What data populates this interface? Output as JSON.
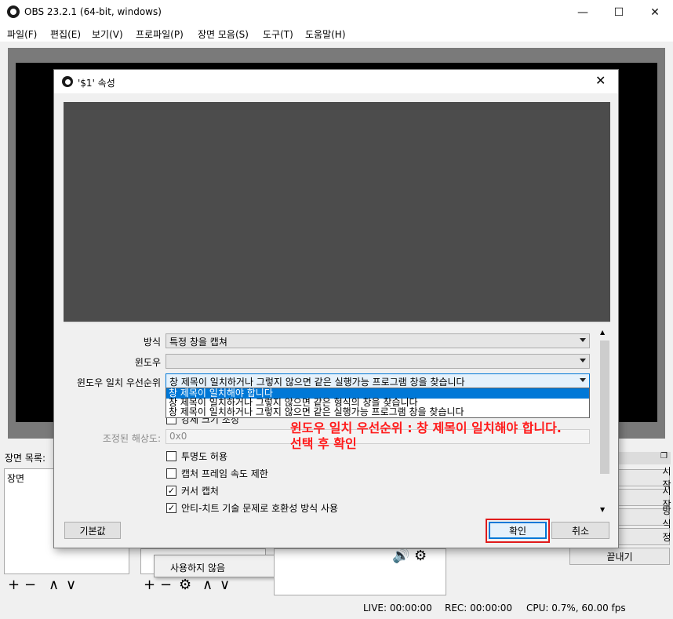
{
  "window": {
    "title": "OBS 23.2.1 (64-bit, windows)",
    "controls": {
      "minimize": "—",
      "maximize": "☐",
      "close": "✕"
    }
  },
  "menu": [
    "파일(F)",
    "편집(E)",
    "보기(V)",
    "프로파일(P)",
    "장면 모음(S)",
    "도구(T)",
    "도움말(H)"
  ],
  "scenes_dock": {
    "title": "장면 목록:",
    "items": [
      "장면"
    ]
  },
  "sources_dock": {
    "context_item": "사용하지 않음"
  },
  "controls_dock": {
    "buttons": [
      "시작",
      "시작",
      "방식",
      "정",
      "끝내기"
    ]
  },
  "status": {
    "live": "LIVE: 00:00:00",
    "rec": "REC: 00:00:00",
    "cpu": "CPU: 0.7%, 60.00 fps"
  },
  "dialog": {
    "title": "'$1' 속성",
    "close_icon": "✕",
    "labels": {
      "method": "방식",
      "window": "윈도우",
      "priority": "윈도우 일치 우선순위",
      "scaled_res": "조정된 해상도:"
    },
    "method_value": "특정 창을 캡쳐",
    "window_value": "",
    "priority_value": "창 제목이 일치하거나 그렇지 않으면 같은 실행가능 프로그램 창을 찾습니다",
    "scaled_res_value": "0x0",
    "hidden_checkbox_label": "강제 크기 조정",
    "checkboxes": [
      {
        "label": "투명도 허용",
        "checked": false
      },
      {
        "label": "캡처 프레임 속도 제한",
        "checked": false
      },
      {
        "label": "커서 캡처",
        "checked": true
      },
      {
        "label": "안티-치트 기술 문제로 호환성 방식 사용",
        "checked": true
      }
    ],
    "buttons": {
      "defaults": "기본값",
      "ok": "확인",
      "cancel": "취소"
    },
    "dropdown_options": [
      "창 제목이 일치해야 합니다",
      "창 제목이 일치하거나 그렇지 않으면 같은 형식의 창을 찾습니다",
      "창 제목이 일치하거나 그렇지 않으면 같은 실행가능 프로그램 창을 찾습니다"
    ]
  },
  "annotation": {
    "line1": "윈도우 일치 우선순위 : 창 제목이 일치해야 합니다.",
    "line2": "선택 후 확인"
  },
  "colors": {
    "highlight": "#0078d7",
    "annotation": "#ff1a1a",
    "preview": "#4c4c4c"
  }
}
